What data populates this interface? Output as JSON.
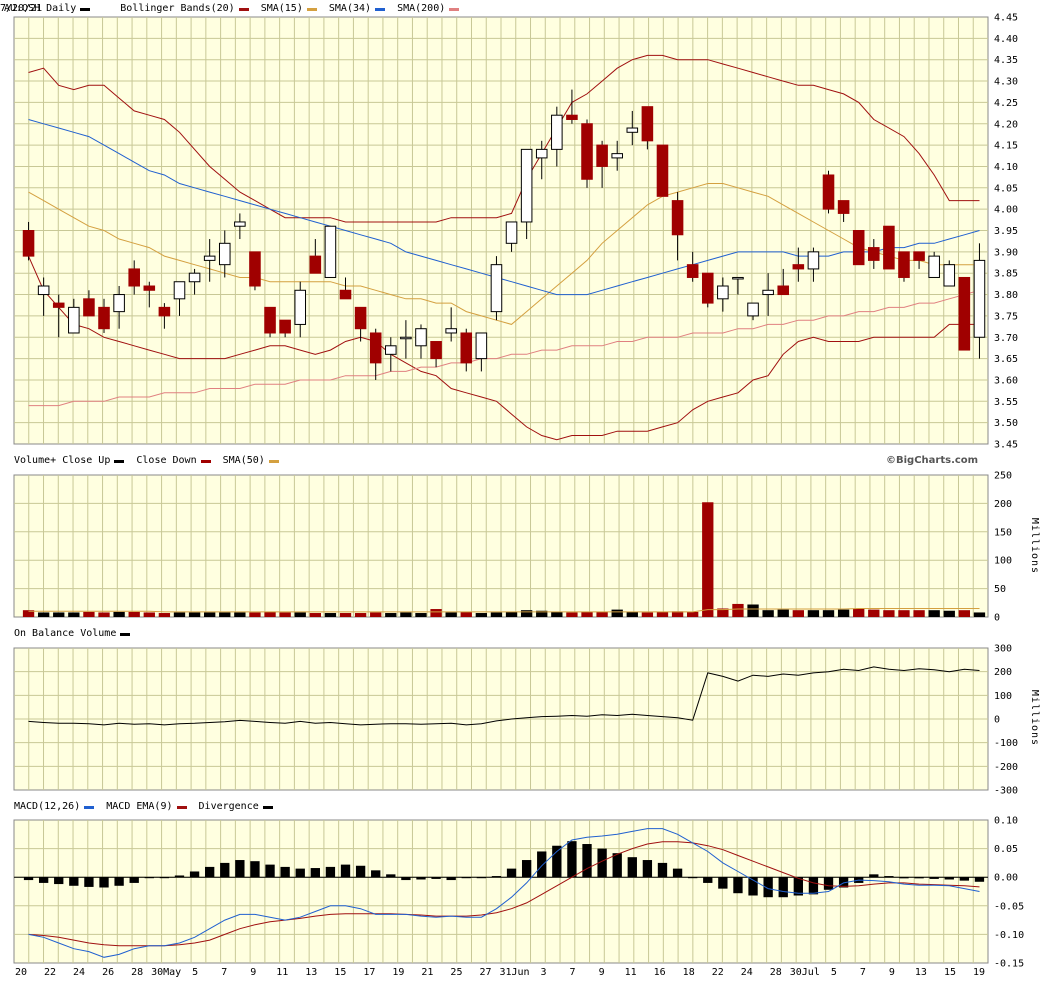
{
  "header": {
    "symbol": "AU:OSH Daily",
    "date": "7/20/21",
    "legend": [
      {
        "label": "Bollinger Bands(20)",
        "color": "#a01010"
      },
      {
        "label": "SMA(15)",
        "color": "#a01010"
      },
      {
        "label": "SMA(34)",
        "color": "#d4a040"
      },
      {
        "label": "SMA(200)",
        "color": "#2060d0"
      },
      {
        "label": "",
        "color": "#e08080"
      }
    ]
  },
  "volume_header": {
    "title": "Volume+",
    "close_up": "Close Up",
    "close_down": "Close Down",
    "sma": "SMA(50)",
    "credit": "©BigCharts.com"
  },
  "obv_header": {
    "title": "On Balance Volume"
  },
  "macd_header": {
    "title": "MACD(12,26)",
    "ema": "MACD EMA(9)",
    "div": "Divergence"
  },
  "colors": {
    "up": "#ffffff",
    "down": "#a00000",
    "panel": "#ffffe0",
    "grid": "#c8c896",
    "bb": "#a01010",
    "sma34": "#d4a040",
    "sma200": "#2060d0",
    "sma_long": "#e08080"
  },
  "chart_data": [
    {
      "type": "candlestick",
      "title": "AU:OSH Daily",
      "ylim": [
        3.45,
        4.45
      ],
      "y_ticks": [
        "4.45",
        "4.40",
        "4.35",
        "4.30",
        "4.25",
        "4.20",
        "4.15",
        "4.10",
        "4.05",
        "4.00",
        "3.95",
        "3.90",
        "3.85",
        "3.80",
        "3.75",
        "3.70",
        "3.65",
        "3.60",
        "3.55",
        "3.50",
        "3.45"
      ],
      "x_labels": [
        "20",
        "22",
        "24",
        "26",
        "28",
        "30May",
        "5",
        "7",
        "9",
        "11",
        "13",
        "15",
        "17",
        "19",
        "21",
        "25",
        "27",
        "31Jun",
        "3",
        "7",
        "9",
        "11",
        "16",
        "18",
        "22",
        "24",
        "28",
        "30Jul",
        "5",
        "7",
        "9",
        "13",
        "15",
        "19"
      ],
      "candles": [
        [
          3.95,
          3.97,
          3.88,
          3.89
        ],
        [
          3.8,
          3.84,
          3.75,
          3.82
        ],
        [
          3.78,
          3.8,
          3.7,
          3.77
        ],
        [
          3.71,
          3.79,
          3.71,
          3.77
        ],
        [
          3.79,
          3.81,
          3.75,
          3.75
        ],
        [
          3.77,
          3.79,
          3.71,
          3.72
        ],
        [
          3.76,
          3.82,
          3.72,
          3.8
        ],
        [
          3.86,
          3.88,
          3.8,
          3.82
        ],
        [
          3.82,
          3.83,
          3.77,
          3.81
        ],
        [
          3.77,
          3.78,
          3.72,
          3.75
        ],
        [
          3.79,
          3.82,
          3.75,
          3.83
        ],
        [
          3.83,
          3.86,
          3.8,
          3.85
        ],
        [
          3.88,
          3.93,
          3.83,
          3.89
        ],
        [
          3.87,
          3.95,
          3.84,
          3.92
        ],
        [
          3.96,
          3.99,
          3.93,
          3.97
        ],
        [
          3.9,
          3.9,
          3.81,
          3.82
        ],
        [
          3.77,
          3.77,
          3.7,
          3.71
        ],
        [
          3.74,
          3.74,
          3.7,
          3.71
        ],
        [
          3.73,
          3.83,
          3.7,
          3.81
        ],
        [
          3.89,
          3.93,
          3.85,
          3.85
        ],
        [
          3.84,
          3.87,
          3.84,
          3.96
        ],
        [
          3.81,
          3.84,
          3.79,
          3.79
        ],
        [
          3.77,
          3.77,
          3.69,
          3.72
        ],
        [
          3.71,
          3.72,
          3.6,
          3.64
        ],
        [
          3.66,
          3.7,
          3.62,
          3.68
        ],
        [
          3.7,
          3.74,
          3.65,
          3.7
        ],
        [
          3.68,
          3.73,
          3.65,
          3.72
        ],
        [
          3.69,
          3.69,
          3.63,
          3.65
        ],
        [
          3.71,
          3.77,
          3.69,
          3.72
        ],
        [
          3.71,
          3.72,
          3.62,
          3.64
        ],
        [
          3.65,
          3.71,
          3.62,
          3.71
        ],
        [
          3.76,
          3.89,
          3.74,
          3.87
        ],
        [
          3.92,
          3.96,
          3.9,
          3.97
        ],
        [
          3.97,
          4.03,
          3.93,
          4.14
        ],
        [
          4.12,
          4.16,
          4.07,
          4.14
        ],
        [
          4.14,
          4.24,
          4.1,
          4.22
        ],
        [
          4.22,
          4.28,
          4.2,
          4.21
        ],
        [
          4.2,
          4.21,
          4.05,
          4.07
        ],
        [
          4.15,
          4.16,
          4.05,
          4.1
        ],
        [
          4.12,
          4.16,
          4.09,
          4.13
        ],
        [
          4.18,
          4.23,
          4.15,
          4.19
        ],
        [
          4.24,
          4.24,
          4.14,
          4.16
        ],
        [
          4.15,
          4.15,
          4.03,
          4.03
        ],
        [
          4.02,
          4.04,
          3.88,
          3.94
        ],
        [
          3.87,
          3.9,
          3.83,
          3.84
        ],
        [
          3.85,
          3.85,
          3.77,
          3.78
        ],
        [
          3.79,
          3.84,
          3.76,
          3.82
        ],
        [
          3.84,
          3.84,
          3.8,
          3.84
        ],
        [
          3.75,
          3.78,
          3.74,
          3.78
        ],
        [
          3.8,
          3.85,
          3.75,
          3.81
        ],
        [
          3.82,
          3.86,
          3.8,
          3.8
        ],
        [
          3.87,
          3.91,
          3.83,
          3.86
        ],
        [
          3.86,
          3.91,
          3.83,
          3.9
        ],
        [
          4.08,
          4.09,
          3.99,
          4.0
        ],
        [
          4.02,
          4.02,
          3.97,
          3.99
        ],
        [
          3.95,
          3.95,
          3.87,
          3.87
        ],
        [
          3.91,
          3.93,
          3.86,
          3.88
        ],
        [
          3.96,
          3.96,
          3.86,
          3.86
        ],
        [
          3.9,
          3.9,
          3.83,
          3.84
        ],
        [
          3.9,
          3.9,
          3.86,
          3.88
        ],
        [
          3.84,
          3.9,
          3.84,
          3.89
        ],
        [
          3.82,
          3.88,
          3.82,
          3.87
        ],
        [
          3.84,
          3.84,
          3.67,
          3.67
        ],
        [
          3.7,
          3.92,
          3.65,
          3.88
        ]
      ],
      "bb_upper": [
        4.32,
        4.33,
        4.29,
        4.28,
        4.29,
        4.29,
        4.26,
        4.23,
        4.22,
        4.21,
        4.18,
        4.14,
        4.1,
        4.07,
        4.04,
        4.02,
        4.0,
        3.98,
        3.98,
        3.98,
        3.98,
        3.97,
        3.97,
        3.97,
        3.97,
        3.97,
        3.97,
        3.97,
        3.98,
        3.98,
        3.98,
        3.98,
        3.99,
        4.07,
        4.13,
        4.19,
        4.25,
        4.27,
        4.3,
        4.33,
        4.35,
        4.36,
        4.36,
        4.35,
        4.35,
        4.35,
        4.34,
        4.33,
        4.32,
        4.31,
        4.3,
        4.29,
        4.29,
        4.28,
        4.27,
        4.25,
        4.21,
        4.19,
        4.17,
        4.13,
        4.08,
        4.02,
        4.02,
        4.02
      ],
      "bb_lower": [
        3.89,
        3.81,
        3.77,
        3.73,
        3.72,
        3.7,
        3.69,
        3.68,
        3.67,
        3.66,
        3.65,
        3.65,
        3.65,
        3.65,
        3.66,
        3.67,
        3.68,
        3.68,
        3.67,
        3.66,
        3.67,
        3.69,
        3.7,
        3.69,
        3.66,
        3.64,
        3.62,
        3.61,
        3.58,
        3.57,
        3.56,
        3.55,
        3.52,
        3.49,
        3.47,
        3.46,
        3.47,
        3.47,
        3.47,
        3.48,
        3.48,
        3.48,
        3.49,
        3.5,
        3.53,
        3.55,
        3.56,
        3.57,
        3.6,
        3.61,
        3.66,
        3.69,
        3.7,
        3.69,
        3.69,
        3.69,
        3.7,
        3.7,
        3.7,
        3.7,
        3.7,
        3.73,
        3.73,
        3.73
      ],
      "sma34": [
        4.04,
        4.02,
        4.0,
        3.98,
        3.96,
        3.95,
        3.93,
        3.92,
        3.91,
        3.89,
        3.88,
        3.87,
        3.86,
        3.85,
        3.84,
        3.84,
        3.83,
        3.83,
        3.83,
        3.83,
        3.83,
        3.82,
        3.82,
        3.81,
        3.8,
        3.79,
        3.79,
        3.78,
        3.78,
        3.76,
        3.75,
        3.74,
        3.73,
        3.76,
        3.79,
        3.82,
        3.85,
        3.88,
        3.92,
        3.95,
        3.98,
        4.01,
        4.03,
        4.04,
        4.05,
        4.06,
        4.06,
        4.05,
        4.04,
        4.03,
        4.01,
        3.99,
        3.97,
        3.95,
        3.93,
        3.91,
        3.9,
        3.89,
        3.88,
        3.88,
        3.87,
        3.87,
        3.87,
        3.87
      ],
      "sma200": [
        4.21,
        4.2,
        4.19,
        4.18,
        4.17,
        4.15,
        4.13,
        4.11,
        4.09,
        4.08,
        4.06,
        4.05,
        4.04,
        4.03,
        4.02,
        4.01,
        4.0,
        3.99,
        3.98,
        3.97,
        3.96,
        3.95,
        3.94,
        3.93,
        3.92,
        3.9,
        3.89,
        3.88,
        3.87,
        3.86,
        3.85,
        3.84,
        3.83,
        3.82,
        3.81,
        3.8,
        3.8,
        3.8,
        3.81,
        3.82,
        3.83,
        3.84,
        3.85,
        3.86,
        3.87,
        3.88,
        3.89,
        3.9,
        3.9,
        3.9,
        3.9,
        3.89,
        3.89,
        3.89,
        3.9,
        3.9,
        3.9,
        3.91,
        3.91,
        3.92,
        3.92,
        3.93,
        3.94,
        3.95
      ],
      "sma_long": [
        3.54,
        3.54,
        3.54,
        3.55,
        3.55,
        3.55,
        3.56,
        3.56,
        3.56,
        3.57,
        3.57,
        3.57,
        3.58,
        3.58,
        3.58,
        3.59,
        3.59,
        3.59,
        3.6,
        3.6,
        3.6,
        3.61,
        3.61,
        3.61,
        3.62,
        3.62,
        3.63,
        3.63,
        3.64,
        3.64,
        3.65,
        3.65,
        3.66,
        3.66,
        3.67,
        3.67,
        3.68,
        3.68,
        3.68,
        3.69,
        3.69,
        3.7,
        3.7,
        3.7,
        3.71,
        3.71,
        3.71,
        3.72,
        3.72,
        3.73,
        3.73,
        3.74,
        3.74,
        3.75,
        3.75,
        3.76,
        3.76,
        3.77,
        3.77,
        3.78,
        3.78,
        3.79,
        3.8,
        3.81
      ]
    },
    {
      "type": "bar",
      "title": "Volume+",
      "ylabel": "Millions",
      "ylim": [
        0,
        250
      ],
      "y_ticks": [
        "250",
        "200",
        "150",
        "100",
        "50",
        "0"
      ],
      "values": [
        12,
        8,
        8,
        8,
        9,
        8,
        9,
        9,
        8,
        7,
        8,
        8,
        8,
        8,
        8,
        8,
        9,
        8,
        8,
        7,
        7,
        7,
        7,
        8,
        7,
        8,
        7,
        14,
        8,
        9,
        7,
        8,
        9,
        12,
        11,
        9,
        8,
        9,
        9,
        13,
        9,
        8,
        9,
        10,
        9,
        202,
        15,
        23,
        22,
        12,
        13,
        12,
        12,
        12,
        13,
        15,
        13,
        12,
        12,
        12,
        12,
        11,
        12,
        8,
        28
      ],
      "up": [
        0,
        1,
        1,
        1,
        0,
        0,
        1,
        0,
        0,
        0,
        1,
        1,
        1,
        1,
        1,
        0,
        0,
        0,
        1,
        0,
        1,
        0,
        0,
        0,
        1,
        1,
        1,
        0,
        1,
        0,
        1,
        1,
        1,
        1,
        1,
        1,
        0,
        0,
        0,
        1,
        1,
        0,
        0,
        0,
        0,
        0,
        0,
        0,
        1,
        1,
        1,
        0,
        1,
        1,
        1,
        0,
        0,
        0,
        0,
        0,
        1,
        1,
        0,
        1,
        1
      ],
      "sma50": [
        10,
        10,
        10,
        10,
        10,
        10,
        10,
        10,
        10,
        9,
        9,
        9,
        9,
        9,
        9,
        9,
        9,
        9,
        9,
        9,
        9,
        9,
        9,
        9,
        9,
        9,
        9,
        9,
        9,
        9,
        9,
        9,
        9,
        9,
        9,
        9,
        9,
        9,
        9,
        9,
        9,
        9,
        9,
        9,
        9,
        13,
        13,
        14,
        14,
        14,
        14,
        14,
        14,
        14,
        14,
        15,
        15,
        15,
        15,
        15,
        15,
        15,
        15,
        15,
        16
      ]
    },
    {
      "type": "line",
      "title": "On Balance Volume",
      "ylabel": "Millions",
      "ylim": [
        -300,
        300
      ],
      "y_ticks": [
        "300",
        "200",
        "100",
        "0",
        "-100",
        "-200",
        "-300"
      ],
      "values": [
        -10,
        -15,
        -18,
        -18,
        -20,
        -25,
        -18,
        -22,
        -20,
        -25,
        -20,
        -18,
        -15,
        -12,
        -6,
        -10,
        -15,
        -18,
        -10,
        -18,
        -15,
        -20,
        -25,
        -22,
        -20,
        -20,
        -22,
        -20,
        -18,
        -25,
        -20,
        -8,
        0,
        5,
        10,
        12,
        15,
        12,
        18,
        15,
        20,
        15,
        10,
        5,
        -5,
        195,
        180,
        160,
        185,
        180,
        190,
        185,
        195,
        200,
        210,
        205,
        220,
        210,
        205,
        212,
        208,
        200,
        210,
        205,
        215,
        205,
        222
      ]
    },
    {
      "type": "bar",
      "title": "MACD(12,26)",
      "ylim": [
        -0.15,
        0.1
      ],
      "y_ticks": [
        "0.10",
        "0.05",
        "0.00",
        "-0.05",
        "-0.10",
        "-0.15"
      ],
      "macd": [
        -0.1,
        -0.105,
        -0.115,
        -0.125,
        -0.13,
        -0.14,
        -0.135,
        -0.125,
        -0.12,
        -0.12,
        -0.115,
        -0.105,
        -0.09,
        -0.075,
        -0.065,
        -0.065,
        -0.07,
        -0.075,
        -0.07,
        -0.06,
        -0.05,
        -0.05,
        -0.055,
        -0.065,
        -0.065,
        -0.065,
        -0.068,
        -0.07,
        -0.068,
        -0.07,
        -0.07,
        -0.055,
        -0.035,
        -0.01,
        0.02,
        0.045,
        0.065,
        0.07,
        0.072,
        0.075,
        0.08,
        0.085,
        0.085,
        0.075,
        0.06,
        0.045,
        0.025,
        0.01,
        -0.005,
        -0.02,
        -0.025,
        -0.028,
        -0.028,
        -0.025,
        -0.01,
        -0.005,
        -0.006,
        -0.008,
        -0.012,
        -0.014,
        -0.014,
        -0.015,
        -0.02,
        -0.025,
        -0.02
      ],
      "ema": [
        -0.1,
        -0.102,
        -0.105,
        -0.11,
        -0.115,
        -0.118,
        -0.12,
        -0.12,
        -0.12,
        -0.12,
        -0.118,
        -0.115,
        -0.11,
        -0.1,
        -0.09,
        -0.083,
        -0.078,
        -0.075,
        -0.072,
        -0.068,
        -0.065,
        -0.064,
        -0.064,
        -0.064,
        -0.064,
        -0.065,
        -0.066,
        -0.068,
        -0.068,
        -0.068,
        -0.066,
        -0.062,
        -0.055,
        -0.045,
        -0.03,
        -0.015,
        0.0,
        0.015,
        0.028,
        0.04,
        0.05,
        0.058,
        0.062,
        0.062,
        0.06,
        0.055,
        0.048,
        0.038,
        0.028,
        0.018,
        0.008,
        -0.002,
        -0.01,
        -0.015,
        -0.016,
        -0.015,
        -0.012,
        -0.01,
        -0.01,
        -0.012,
        -0.013,
        -0.014,
        -0.015,
        -0.017,
        -0.017
      ],
      "divergence": [
        -0.005,
        -0.01,
        -0.012,
        -0.015,
        -0.017,
        -0.018,
        -0.015,
        -0.01,
        0.0,
        0.0,
        0.003,
        0.01,
        0.018,
        0.025,
        0.03,
        0.028,
        0.022,
        0.018,
        0.015,
        0.016,
        0.018,
        0.022,
        0.02,
        0.012,
        0.005,
        -0.005,
        -0.004,
        -0.003,
        -0.005,
        0.0,
        0.0,
        0.002,
        0.015,
        0.03,
        0.045,
        0.055,
        0.063,
        0.058,
        0.05,
        0.042,
        0.035,
        0.03,
        0.025,
        0.015,
        0.0,
        -0.01,
        -0.02,
        -0.028,
        -0.032,
        -0.035,
        -0.035,
        -0.032,
        -0.03,
        -0.022,
        -0.018,
        -0.01,
        0.005,
        0.002,
        -0.002,
        -0.002,
        -0.003,
        -0.004,
        -0.006,
        -0.008,
        -0.012
      ]
    }
  ]
}
